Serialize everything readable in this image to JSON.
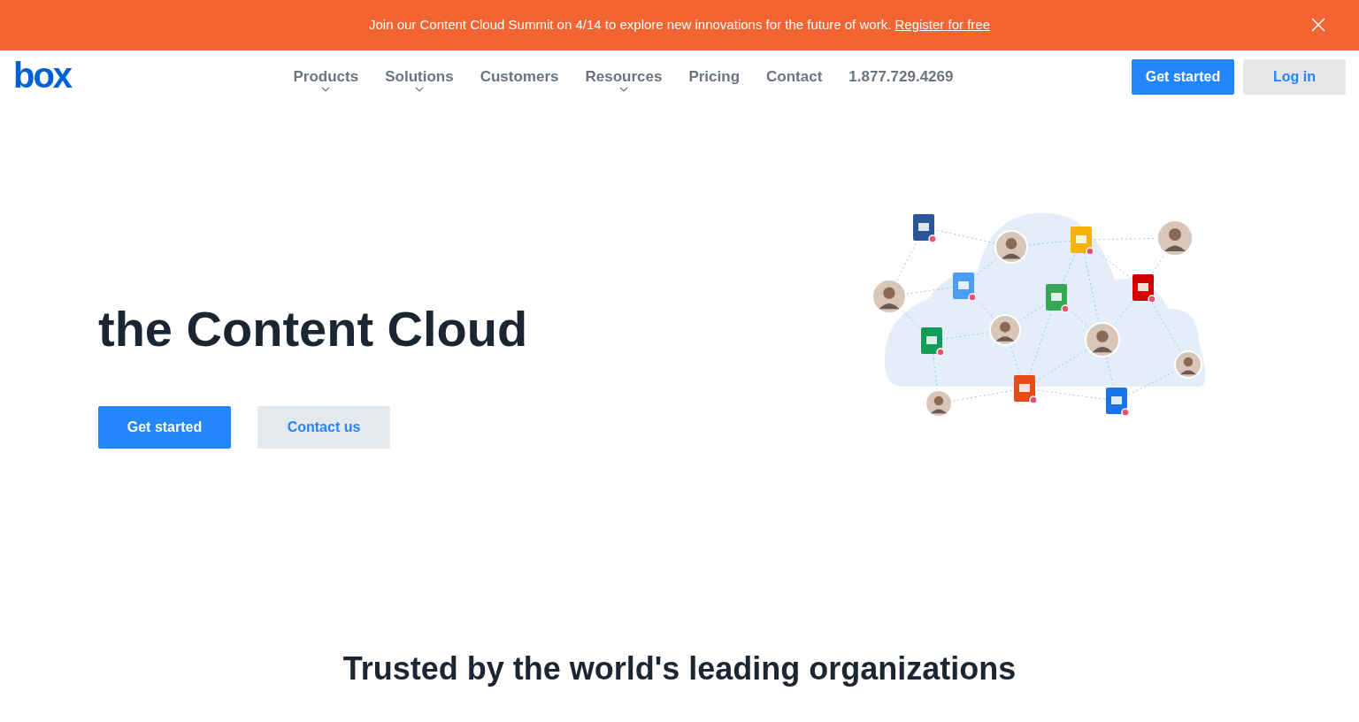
{
  "banner": {
    "text": "Join our Content Cloud Summit on 4/14 to explore new innovations for the future of work.",
    "link": "Register for free"
  },
  "header": {
    "logo": "box",
    "nav": [
      {
        "label": "Products",
        "has_menu": true
      },
      {
        "label": "Solutions",
        "has_menu": true
      },
      {
        "label": "Customers",
        "has_menu": false
      },
      {
        "label": "Resources",
        "has_menu": true
      },
      {
        "label": "Pricing",
        "has_menu": false
      },
      {
        "label": "Contact",
        "has_menu": false
      },
      {
        "label": "1.877.729.4269",
        "has_menu": false
      }
    ],
    "buttons": [
      {
        "label": "Get started",
        "kind": "primary"
      },
      {
        "label": "Log in",
        "kind": "secondary"
      }
    ]
  },
  "hero": {
    "title": "the Content Cloud",
    "buttons": [
      {
        "label": "Get started",
        "kind": "primary"
      },
      {
        "label": "Contact us",
        "kind": "secondary"
      }
    ]
  },
  "trusted": {
    "heading": "Trusted by the world's leading organizations"
  }
}
